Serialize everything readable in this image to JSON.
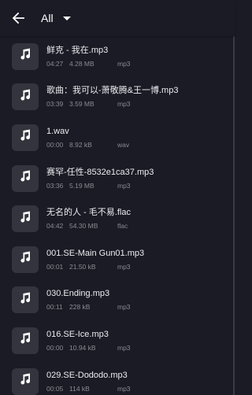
{
  "header": {
    "back_icon": "arrow-left-icon",
    "filter_label": "All",
    "filter_icon": "caret-down-icon"
  },
  "files": [
    {
      "title": "鲜克 - 我在.mp3",
      "duration": "04:27",
      "size": "4.28 MB",
      "format": "mp3"
    },
    {
      "title": "歌曲：我可以-萧敬腾&王一博.mp3",
      "duration": "03:39",
      "size": "3.59 MB",
      "format": "mp3"
    },
    {
      "title": "1.wav",
      "duration": "00:00",
      "size": "8.92 kB",
      "format": "wav"
    },
    {
      "title": "赛罕-任性-8532e1ca37.mp3",
      "duration": "03:36",
      "size": "5.19 MB",
      "format": "mp3"
    },
    {
      "title": "无名的人 - 毛不易.flac",
      "duration": "04:42",
      "size": "54.30 MB",
      "format": "flac"
    },
    {
      "title": "001.SE-Main Gun01.mp3",
      "duration": "00:01",
      "size": "21.50 kB",
      "format": "mp3"
    },
    {
      "title": "030.Ending.mp3",
      "duration": "00:11",
      "size": "228 kB",
      "format": "mp3"
    },
    {
      "title": "016.SE-Ice.mp3",
      "duration": "00:00",
      "size": "10.94 kB",
      "format": "mp3"
    },
    {
      "title": "029.SE-Dododo.mp3",
      "duration": "00:05",
      "size": "114 kB",
      "format": "mp3"
    }
  ],
  "file_icon": "music-note-icon"
}
